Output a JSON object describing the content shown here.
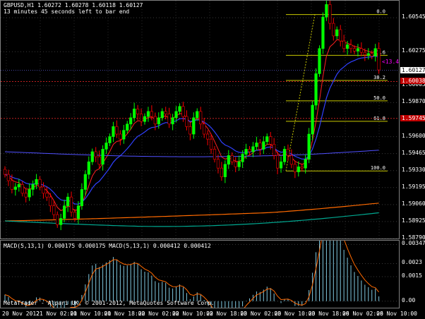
{
  "header": {
    "symbol_line": "GBPUSD,H1  1.60272 1.60278 1.60118 1.60127",
    "countdown": "13 minutes 45 seconds left to bar end"
  },
  "price_axis": {
    "ticks": [
      "1.60545",
      "1.60275",
      "1.60005",
      "1.59870",
      "1.59600",
      "1.59465",
      "1.59330",
      "1.59195",
      "1.59060",
      "1.58925",
      "1.58790"
    ],
    "bid_tag": "1.60127",
    "red_tag_1": "1.60038",
    "red_tag_2": "1.59745"
  },
  "fibonacci": {
    "levels": [
      "0.0",
      "23.6",
      "38.2",
      "50.0",
      "61.8",
      "100.0"
    ],
    "color": "#c8c800"
  },
  "pip_label": "<13.45",
  "macd": {
    "header": "MACD(5,13,1) 0.000175 0.000175  MACD(5,13,1) 0.000412 0.000412",
    "ticks": [
      "0.00347",
      "0.0023",
      "0.0015",
      "0.00"
    ],
    "histogram_color": "#80c8e0",
    "signal_color": "#ff6a00"
  },
  "time_axis": {
    "ticks": [
      "20 Nov 2012",
      "21 Nov 02:00",
      "21 Nov 10:00",
      "21 Nov 18:00",
      "22 Nov 02:00",
      "22 Nov 10:00",
      "22 Nov 18:00",
      "23 Nov 02:00",
      "23 Nov 10:00",
      "23 Nov 18:00",
      "26 Nov 02:00",
      "26 Nov 10:00"
    ]
  },
  "copyright": "MetaTrader - Alpari UK, © 2001-2012, MetaQuotes Software Corp.",
  "chart_data": {
    "type": "candlestick",
    "symbol": "GBPUSD",
    "timeframe": "H1",
    "ohlc_last": {
      "open": 1.60272,
      "high": 1.60278,
      "low": 1.60118,
      "close": 1.60127
    },
    "ylim": [
      1.5879,
      1.6068
    ],
    "closes": [
      1.593,
      1.5925,
      1.5918,
      1.592,
      1.5922,
      1.5915,
      1.5912,
      1.5918,
      1.5922,
      1.5926,
      1.592,
      1.5915,
      1.5912,
      1.5905,
      1.5898,
      1.589,
      1.5895,
      1.5905,
      1.5912,
      1.59,
      1.5895,
      1.5905,
      1.5918,
      1.593,
      1.594,
      1.5948,
      1.5944,
      1.5938,
      1.595,
      1.5955,
      1.596,
      1.5968,
      1.5962,
      1.5958,
      1.5965,
      1.597,
      1.5975,
      1.5982,
      1.5978,
      1.5972,
      1.5976,
      1.598,
      1.5976,
      1.597,
      1.5975,
      1.598,
      1.5978,
      1.597,
      1.5975,
      1.598,
      1.5984,
      1.5976,
      1.5968,
      1.5962,
      1.5975,
      1.598,
      1.597,
      1.5962,
      1.5958,
      1.595,
      1.5942,
      1.5935,
      1.5928,
      1.5938,
      1.5945,
      1.594,
      1.5936,
      1.594,
      1.5946,
      1.595,
      1.5948,
      1.5952,
      1.5955,
      1.595,
      1.5956,
      1.596,
      1.5954,
      1.5945,
      1.5935,
      1.594,
      1.595,
      1.5945,
      1.5938,
      1.5932,
      1.5936,
      1.5935,
      1.5942,
      1.5962,
      1.5985,
      1.601,
      1.603,
      1.6055,
      1.6065,
      1.605,
      1.604,
      1.6045,
      1.6036,
      1.603,
      1.6033,
      1.603,
      1.6028,
      1.603,
      1.6027,
      1.6025,
      1.6026,
      1.6024,
      1.603,
      1.6013
    ],
    "overlays": [
      {
        "color": "#ff2020",
        "kind": "EMA fast"
      },
      {
        "color": "#3040ff",
        "kind": "EMA slow"
      },
      {
        "color": "#ff6a00",
        "kind": "long MA"
      },
      {
        "color": "#5050ff",
        "kind": "MA"
      },
      {
        "color": "#00a890",
        "kind": "long MA"
      }
    ]
  }
}
